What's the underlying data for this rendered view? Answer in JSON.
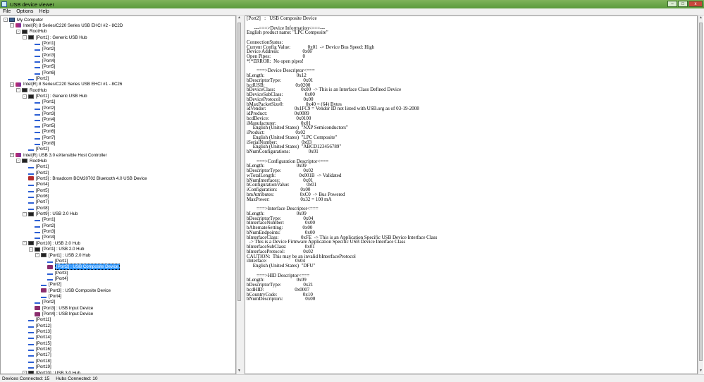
{
  "window": {
    "title": "USB device viewer",
    "buttons": [
      "–",
      "□",
      "x"
    ]
  },
  "menu": [
    "File",
    "Options",
    "Help"
  ],
  "tree": [
    {
      "indent": 0,
      "exp": "-",
      "icon": "computer",
      "label": "My Computer"
    },
    {
      "indent": 1,
      "exp": "-",
      "icon": "controller",
      "label": "Intel(R) 8 Series/C220 Series USB EHCI #2 - 8C2D"
    },
    {
      "indent": 2,
      "exp": "-",
      "icon": "hub",
      "label": "RootHub"
    },
    {
      "indent": 3,
      "exp": "-",
      "icon": "hub",
      "label": "[Port1]  :  Generic USB Hub"
    },
    {
      "indent": 4,
      "exp": "",
      "icon": "port",
      "label": "[Port1]"
    },
    {
      "indent": 4,
      "exp": "",
      "icon": "port",
      "label": "[Port2]"
    },
    {
      "indent": 4,
      "exp": "",
      "icon": "port",
      "label": "[Port3]"
    },
    {
      "indent": 4,
      "exp": "",
      "icon": "port",
      "label": "[Port4]"
    },
    {
      "indent": 4,
      "exp": "",
      "icon": "port",
      "label": "[Port5]"
    },
    {
      "indent": 4,
      "exp": "",
      "icon": "port",
      "label": "[Port6]"
    },
    {
      "indent": 3,
      "exp": "",
      "icon": "port",
      "label": "[Port2]"
    },
    {
      "indent": 1,
      "exp": "-",
      "icon": "controller",
      "label": "Intel(R) 8 Series/C220 Series USB EHCI #1 - 8C26"
    },
    {
      "indent": 2,
      "exp": "-",
      "icon": "hub",
      "label": "RootHub"
    },
    {
      "indent": 3,
      "exp": "-",
      "icon": "hub",
      "label": "[Port1]  :  Generic USB Hub"
    },
    {
      "indent": 4,
      "exp": "",
      "icon": "port",
      "label": "[Port1]"
    },
    {
      "indent": 4,
      "exp": "",
      "icon": "port",
      "label": "[Port2]"
    },
    {
      "indent": 4,
      "exp": "",
      "icon": "port",
      "label": "[Port3]"
    },
    {
      "indent": 4,
      "exp": "",
      "icon": "port",
      "label": "[Port4]"
    },
    {
      "indent": 4,
      "exp": "",
      "icon": "port",
      "label": "[Port5]"
    },
    {
      "indent": 4,
      "exp": "",
      "icon": "port",
      "label": "[Port6]"
    },
    {
      "indent": 4,
      "exp": "",
      "icon": "port",
      "label": "[Port7]"
    },
    {
      "indent": 4,
      "exp": "",
      "icon": "port",
      "label": "[Port8]"
    },
    {
      "indent": 3,
      "exp": "",
      "icon": "port",
      "label": "[Port2]"
    },
    {
      "indent": 1,
      "exp": "-",
      "icon": "controller",
      "label": "Intel(R) USB 3.0 eXtensible Host Controller"
    },
    {
      "indent": 2,
      "exp": "-",
      "icon": "hub",
      "label": "RootHub"
    },
    {
      "indent": 3,
      "exp": "",
      "icon": "port",
      "label": "[Port1]"
    },
    {
      "indent": 3,
      "exp": "",
      "icon": "port",
      "label": "[Port2]"
    },
    {
      "indent": 3,
      "exp": "",
      "icon": "bt",
      "label": "[Port3]  :  Broadcom BCM20702 Bluetooth 4.0 USB Device"
    },
    {
      "indent": 3,
      "exp": "",
      "icon": "port",
      "label": "[Port4]"
    },
    {
      "indent": 3,
      "exp": "",
      "icon": "port",
      "label": "[Port5]"
    },
    {
      "indent": 3,
      "exp": "",
      "icon": "port",
      "label": "[Port6]"
    },
    {
      "indent": 3,
      "exp": "",
      "icon": "port",
      "label": "[Port7]"
    },
    {
      "indent": 3,
      "exp": "",
      "icon": "port",
      "label": "[Port8]"
    },
    {
      "indent": 3,
      "exp": "-",
      "icon": "hub",
      "label": "[Port9]  :  USB 2.0 Hub"
    },
    {
      "indent": 4,
      "exp": "",
      "icon": "port",
      "label": "[Port1]"
    },
    {
      "indent": 4,
      "exp": "",
      "icon": "port",
      "label": "[Port2]"
    },
    {
      "indent": 4,
      "exp": "",
      "icon": "port",
      "label": "[Port3]"
    },
    {
      "indent": 4,
      "exp": "",
      "icon": "port",
      "label": "[Port4]"
    },
    {
      "indent": 3,
      "exp": "-",
      "icon": "hub",
      "label": "[Port10]  :  USB 2.0 Hub"
    },
    {
      "indent": 4,
      "exp": "-",
      "icon": "hub",
      "label": "[Port1]  :  USB 2.0 Hub"
    },
    {
      "indent": 5,
      "exp": "-",
      "icon": "hub",
      "label": "[Port1]  :  USB 2.0 Hub"
    },
    {
      "indent": 6,
      "exp": "",
      "icon": "port",
      "label": "[Port1]"
    },
    {
      "indent": 6,
      "exp": "",
      "icon": "device",
      "label": "[Port2]  :  USB Composite Device",
      "selected": true
    },
    {
      "indent": 6,
      "exp": "",
      "icon": "port",
      "label": "[Port3]"
    },
    {
      "indent": 6,
      "exp": "",
      "icon": "port",
      "label": "[Port4]"
    },
    {
      "indent": 5,
      "exp": "",
      "icon": "port",
      "label": "[Port2]"
    },
    {
      "indent": 5,
      "exp": "",
      "icon": "device",
      "label": "[Port3]  :  USB Composite Device"
    },
    {
      "indent": 5,
      "exp": "",
      "icon": "port",
      "label": "[Port4]"
    },
    {
      "indent": 4,
      "exp": "",
      "icon": "port",
      "label": "[Port2]"
    },
    {
      "indent": 4,
      "exp": "",
      "icon": "device",
      "label": "[Port3]  :  USB Input Device"
    },
    {
      "indent": 4,
      "exp": "",
      "icon": "device",
      "label": "[Port4]  :  USB Input Device"
    },
    {
      "indent": 3,
      "exp": "",
      "icon": "port",
      "label": "[Port11]"
    },
    {
      "indent": 3,
      "exp": "",
      "icon": "port",
      "label": "[Port12]"
    },
    {
      "indent": 3,
      "exp": "",
      "icon": "port",
      "label": "[Port13]"
    },
    {
      "indent": 3,
      "exp": "",
      "icon": "port",
      "label": "[Port14]"
    },
    {
      "indent": 3,
      "exp": "",
      "icon": "port",
      "label": "[Port15]"
    },
    {
      "indent": 3,
      "exp": "",
      "icon": "port",
      "label": "[Port16]"
    },
    {
      "indent": 3,
      "exp": "",
      "icon": "port",
      "label": "[Port17]"
    },
    {
      "indent": 3,
      "exp": "",
      "icon": "port",
      "label": "[Port18]"
    },
    {
      "indent": 3,
      "exp": "",
      "icon": "port",
      "label": "[Port19]"
    },
    {
      "indent": 3,
      "exp": "-",
      "icon": "hub",
      "label": "[Port20]  :  USB 3.0 Hub"
    }
  ],
  "detail_lines": [
    "[Port2]   :   USB Composite Device",
    "",
    "      ---===>Device Information<===---",
    "English product name: \"LPC Composite\"",
    "",
    "ConnectionStatus:",
    "Current Config Value:              0x01  -> Device Bus Speed: High",
    "Device Address:                   0x0F",
    "Open Pipes:                          0",
    "*!*ERROR:  No open pipes!",
    "",
    "        ===>Device Descriptor<===",
    "bLength:                          0x12",
    "bDescriptorType:                  0x01",
    "bcdUSB:                         0x0200",
    "bDeviceClass:                     0x00  -> This is an Interface Class Defined Device",
    "bDeviceSubClass:                  0x00",
    "bDeviceProtocol:                  0x00",
    "bMaxPacketSize0:                  0x40 = (64) Bytes",
    "idVendor:                       0x1FC9 = Vendor ID not listed with USB.org as of 03-19-2008",
    "idProduct:                      0x0089",
    "bcdDevice:                      0x0100",
    "iManufacturer:                    0x01",
    "     English (United States)  \"NXP Semiconductors\"",
    "iProduct:                         0x02",
    "     English (United States)  \"LPC Composite\"",
    "iSerialNumber:                    0x03",
    "     English (United States)  \"ABCD123456789\"",
    "bNumConfigurations:               0x01",
    "",
    "        ===>Configuration Descriptor<===",
    "bLength:                          0x09",
    "bDescriptorType:                  0x02",
    "wTotalLength:                   0x001B  -> Validated",
    "bNumInterfaces:                   0x01",
    "bConfigurationValue:              0x01",
    "iConfiguration:                   0x00",
    "bmAttributes:                     0xC0  -> Bus Powered",
    "MaxPower:                         0x32 = 100 mA",
    "",
    "        ===>Interface Descriptor<===",
    "bLength:                          0x09",
    "bDescriptorType:                  0x04",
    "bInterfaceNumber:                 0x00",
    "bAlternateSetting:                0x00",
    "bNumEndpoints:                    0x00",
    "bInterfaceClass:                  0xFE  -> This is an Application Specific USB Device Interface Class",
    "  -> This is a Device Firmware Application Specific USB Device Interface Class",
    "bInterfaceSubClass:               0x01",
    "bInterfaceProtocol:               0x02",
    "CAUTION:  This may be an invalid bInterfaceProtocol",
    "iInterface:                       0x04",
    "     English (United States)  \"DFU\"",
    "",
    "        ===>HID Descriptor<===",
    "bLength:                          0x09",
    "bDescriptorType:                  0x21",
    "bcdHID:                         0x0007",
    "bCountryCode:                     0x10",
    "bNumDescriptors:                  0x00"
  ],
  "status": {
    "devices": "Devices Connected: 15",
    "hubs": "Hubs Connected: 10"
  }
}
